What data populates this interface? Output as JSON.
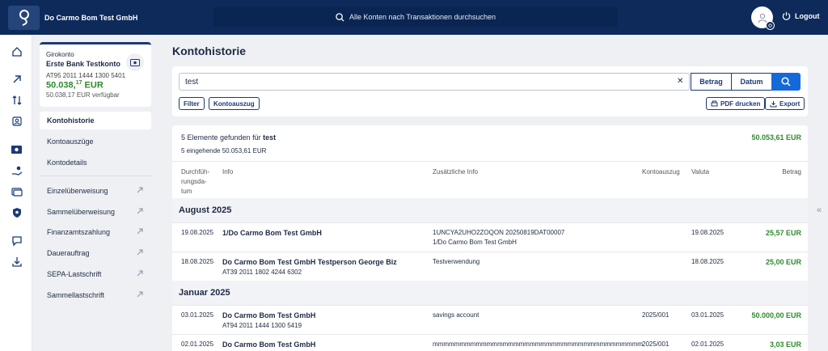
{
  "header": {
    "company": "Do Carmo Bom Test GmbH",
    "search_placeholder": "Alle Konten nach Transaktionen durchsuchen",
    "logout": "Logout"
  },
  "account_card": {
    "type": "Girokonto",
    "name": "Erste Bank Testkonto",
    "iban": "AT95 2011 1444 1300 5401",
    "balance_main": "50.038,",
    "balance_cents": "17",
    "balance_currency": " EUR",
    "available": "50.038,17 EUR verfügbar"
  },
  "subnav": {
    "items": [
      "Kontohistorie",
      "Kontoauszüge",
      "Kontodetails"
    ],
    "transfers": [
      "Einzelüberweisung",
      "Sammelüberweisung",
      "Finanzamtszahlung",
      "Dauerauftrag",
      "SEPA-Lastschrift",
      "Sammellastschrift"
    ]
  },
  "main": {
    "title": "Kontohistorie",
    "search_value": "test",
    "btn_betrag": "Betrag",
    "btn_datum": "Datum",
    "btn_filter": "Filter",
    "btn_kontoauszug": "Kontoauszug",
    "btn_pdf": "PDF drucken",
    "btn_export": "Export"
  },
  "results": {
    "found_prefix": "5 Elemente gefunden für ",
    "found_term": "test",
    "incoming": "5 eingehende 50.053,61 EUR",
    "total": "50.053,61 EUR",
    "columns": {
      "date": "Durchfüh-\nrungsda-\ntum",
      "info": "Info",
      "extra": "Zusätzliche Info",
      "statement": "Kontoauszug",
      "valuta": "Valuta",
      "amount": "Betrag"
    },
    "groups": [
      {
        "label": "August 2025",
        "rows": [
          {
            "date": "19.08.2025",
            "info": "1/Do Carmo Bom Test GmbH",
            "info2": "",
            "extra": "1UNCYA2UHO2ZOQON 20250819DAT00007",
            "extra2": "1/Do Carmo Bom Test GmbH",
            "statement": "",
            "valuta": "19.08.2025",
            "amount": "25,57 EUR"
          },
          {
            "date": "18.08.2025",
            "info": "Do Carmo Bom Test GmbH Testperson George Biz",
            "info2": "AT39 2011 1802 4244 6302",
            "extra": "Testverwendung",
            "extra2": "",
            "statement": "",
            "valuta": "18.08.2025",
            "amount": "25,00 EUR"
          }
        ]
      },
      {
        "label": "Januar 2025",
        "rows": [
          {
            "date": "03.01.2025",
            "info": "Do Carmo Bom Test GmbH",
            "info2": "AT94 2011 1444 1300 5419",
            "extra": "savings account",
            "extra2": "",
            "statement": "2025/001",
            "valuta": "03.01.2025",
            "amount": "50.000,00 EUR"
          },
          {
            "date": "02.01.2025",
            "info": "Do Carmo Bom Test GmbH",
            "info2": "",
            "extra": "mmmmmmmmmmmmmmmmmmmmmmmmmmmmmmmmmmmmmmm",
            "extra2": "",
            "statement": "2025/001",
            "valuta": "02.01.2025",
            "amount": "3,03 EUR"
          }
        ]
      }
    ]
  },
  "colors": {
    "navy": "#0d2a5a",
    "accent_blue": "#1469d9",
    "positive_green": "#2e8a2e"
  }
}
